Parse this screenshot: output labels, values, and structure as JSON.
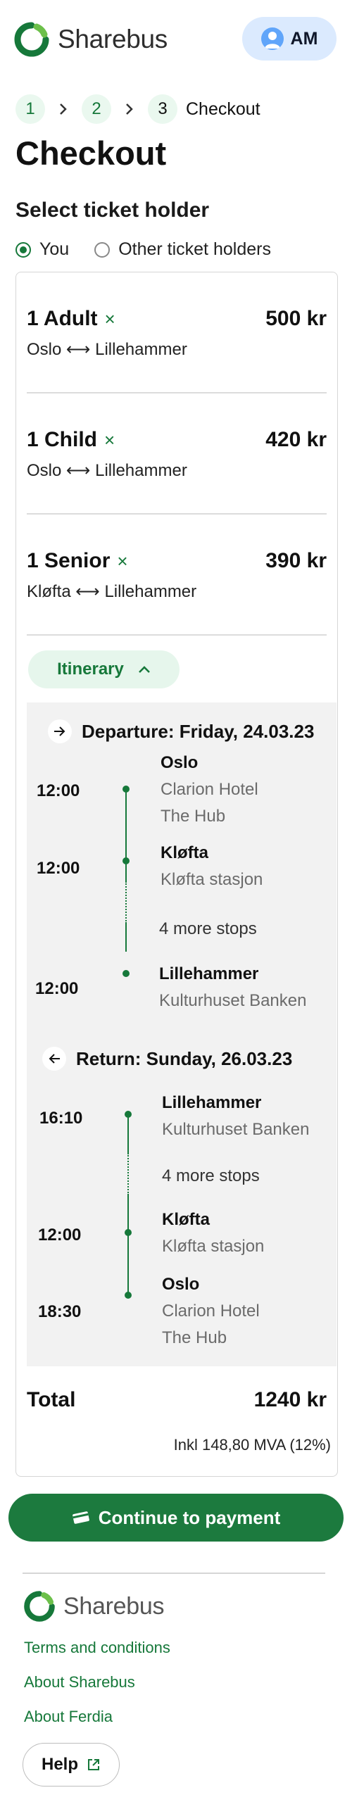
{
  "header": {
    "brand": "Sharebus",
    "user_initials": "AM",
    "brand_color": "#16783a"
  },
  "breadcrumb": {
    "steps": [
      "1",
      "2",
      "3"
    ],
    "current_label": "Checkout"
  },
  "page_title": "Checkout",
  "ticket_holder": {
    "title": "Select ticket holder",
    "options": [
      "You",
      "Other ticket holders"
    ],
    "selected": "You"
  },
  "tickets": [
    {
      "name": "1 Adult",
      "price": "500 kr",
      "from": "Oslo",
      "to": "Lillehammer",
      "remove": "×"
    },
    {
      "name": "1 Child",
      "price": "420 kr",
      "from": "Oslo",
      "to": "Lillehammer",
      "remove": "×"
    },
    {
      "name": "1 Senior",
      "price": "390 kr",
      "from": "Kløfta",
      "to": "Lillehammer",
      "remove": "×"
    }
  ],
  "route_arrow": "⟷",
  "itinerary": {
    "toggle_label": "Itinerary",
    "departure": {
      "title": "Departure: Friday, 24.03.23",
      "stops": [
        {
          "time": "12:00",
          "name": "Oslo",
          "sub1": "Clarion Hotel",
          "sub2": "The Hub"
        },
        {
          "time": "12:00",
          "name": "Kløfta",
          "sub1": "Kløfta stasjon",
          "sub2": ""
        },
        {
          "time": "12:00",
          "name": "Lillehammer",
          "sub1": "Kulturhuset Banken",
          "sub2": ""
        }
      ],
      "more_stops": "4 more stops"
    },
    "return": {
      "title": "Return: Sunday, 26.03.23",
      "stops": [
        {
          "time": "16:10",
          "name": "Lillehammer",
          "sub1": "Kulturhuset Banken",
          "sub2": ""
        },
        {
          "time": "12:00",
          "name": "Kløfta",
          "sub1": "Kløfta stasjon",
          "sub2": ""
        },
        {
          "time": "18:30",
          "name": "Oslo",
          "sub1": "Clarion Hotel",
          "sub2": "The Hub"
        }
      ],
      "more_stops": "4 more stops"
    }
  },
  "total": {
    "label": "Total",
    "value": "1240 kr",
    "vat": "Inkl 148,80 MVA (12%)"
  },
  "pay_button": "Continue to payment",
  "footer": {
    "brand": "Sharebus",
    "links": [
      "Terms and conditions",
      "About Sharebus",
      "About Ferdia"
    ],
    "help": "Help"
  }
}
